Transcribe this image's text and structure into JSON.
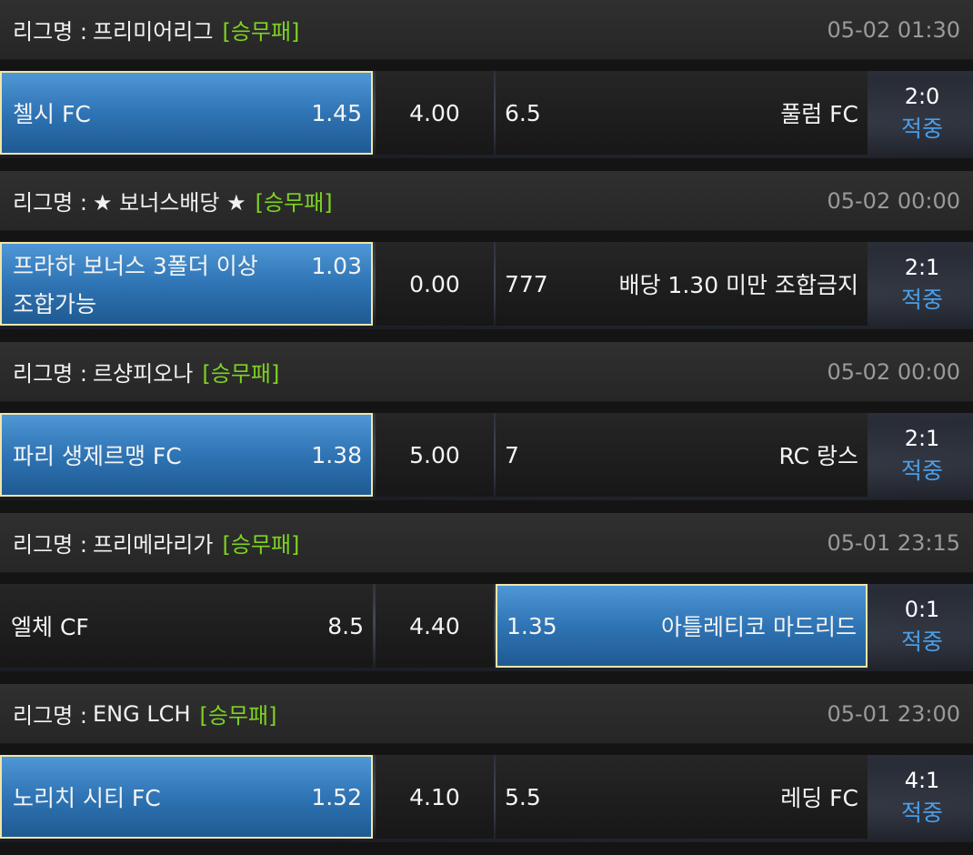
{
  "matches": [
    {
      "league_prefix": "리그명 :",
      "league_name": "프리미어리그",
      "bet_type": "[승무패]",
      "datetime": "05-02 01:30",
      "home_team": "첼시 FC",
      "home_odds": "1.45",
      "draw_odds": "4.00",
      "away_odds": "6.5",
      "away_team": "풀럼 FC",
      "score": "2:0",
      "status": "적중",
      "selected": "home"
    },
    {
      "league_prefix": "리그명 :",
      "league_name": "★ 보너스배당 ★",
      "bet_type": "[승무패]",
      "datetime": "05-02 00:00",
      "home_team_line1": "프라하 보너스 3폴더 이상",
      "home_team_line2": "조합가능",
      "home_odds": "1.03",
      "draw_odds": "0.00",
      "away_odds": "777",
      "away_team": "배당 1.30 미만 조합금지",
      "score": "2:1",
      "status": "적중",
      "selected": "home"
    },
    {
      "league_prefix": "리그명 :",
      "league_name": "르샹피오나",
      "bet_type": "[승무패]",
      "datetime": "05-02 00:00",
      "home_team": "파리 생제르맹 FC",
      "home_odds": "1.38",
      "draw_odds": "5.00",
      "away_odds": "7",
      "away_team": "RC 랑스",
      "score": "2:1",
      "status": "적중",
      "selected": "home"
    },
    {
      "league_prefix": "리그명 :",
      "league_name": "프리메라리가",
      "bet_type": "[승무패]",
      "datetime": "05-01 23:15",
      "home_team": "엘체 CF",
      "home_odds": "8.5",
      "draw_odds": "4.40",
      "away_odds": "1.35",
      "away_team": "아틀레티코 마드리드",
      "score": "0:1",
      "status": "적중",
      "selected": "away"
    },
    {
      "league_prefix": "리그명 :",
      "league_name": "ENG LCH",
      "bet_type": "[승무패]",
      "datetime": "05-01 23:00",
      "home_team": "노리치 시티 FC",
      "home_odds": "1.52",
      "draw_odds": "4.10",
      "away_odds": "5.5",
      "away_team": "레딩 FC",
      "score": "4:1",
      "status": "적중",
      "selected": "home"
    }
  ],
  "colors": {
    "selected_blue": "#2f74b4",
    "selected_border": "#f0e6a8",
    "bet_type_green": "#7ed321",
    "status_blue": "#4a9ee8"
  }
}
